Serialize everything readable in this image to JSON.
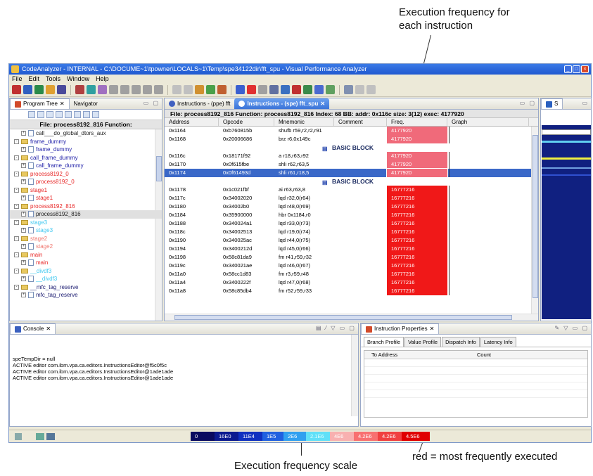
{
  "annotations": {
    "top_right": [
      "Execution frequency for",
      "each instruction"
    ],
    "bottom_center": "Execution frequency scale",
    "bottom_right": "red = most frequently executed"
  },
  "window": {
    "title": "CodeAnalyzer - INTERNAL - C:\\DOCUME~1\\tpowner\\LOCALS~1\\Temp\\spe34122dir\\fft_spu - Visual Performance Analyzer",
    "menu": [
      "File",
      "Edit",
      "Tools",
      "Window",
      "Help"
    ]
  },
  "tree_pane": {
    "tabs": [
      "Program Tree",
      "Navigator"
    ],
    "title": "File: process8192_816 Function:",
    "items": [
      {
        "label": "call___do_global_dtors_aux",
        "color": "dark",
        "kind": "file",
        "expand": "+"
      },
      {
        "label": "frame_dummy",
        "color": "blue",
        "kind": "folder",
        "expand": "-"
      },
      {
        "label": "frame_dummy",
        "color": "blue",
        "kind": "file",
        "expand": "+"
      },
      {
        "label": "call_frame_dummy",
        "color": "blue",
        "kind": "folder",
        "expand": "-"
      },
      {
        "label": "call_frame_dummy",
        "color": "blue",
        "kind": "file",
        "expand": "+"
      },
      {
        "label": "process8192_0",
        "color": "red",
        "kind": "folder",
        "expand": "-"
      },
      {
        "label": "process8192_0",
        "color": "red",
        "kind": "file",
        "expand": "+"
      },
      {
        "label": "stage1",
        "color": "red",
        "kind": "folder",
        "expand": "-"
      },
      {
        "label": "stage1",
        "color": "red",
        "kind": "file",
        "expand": "+"
      },
      {
        "label": "process8192_816",
        "color": "red",
        "kind": "folder",
        "expand": "-"
      },
      {
        "label": "process8192_816",
        "color": "dark",
        "kind": "file",
        "expand": "+",
        "selected": true
      },
      {
        "label": "stage3",
        "color": "cyan",
        "kind": "folder",
        "expand": "-"
      },
      {
        "label": "stage3",
        "color": "cyan",
        "kind": "file",
        "expand": "+"
      },
      {
        "label": "stage2",
        "color": "pink",
        "kind": "folder",
        "expand": "-"
      },
      {
        "label": "stage2",
        "color": "pink",
        "kind": "file",
        "expand": "+"
      },
      {
        "label": "main",
        "color": "red",
        "kind": "folder",
        "expand": "-"
      },
      {
        "label": "main",
        "color": "red",
        "kind": "file",
        "expand": "+"
      },
      {
        "label": "__divdf3",
        "color": "cyan",
        "kind": "folder",
        "expand": "-"
      },
      {
        "label": "__divdf3",
        "color": "cyan",
        "kind": "file",
        "expand": "+"
      },
      {
        "label": "__mfc_tag_reserve",
        "color": "navy",
        "kind": "folder",
        "expand": "-"
      },
      {
        "label": "mfc_tag_reserve",
        "color": "navy",
        "kind": "file",
        "expand": "+"
      }
    ]
  },
  "instr_pane": {
    "tabs": [
      "Instructions - (ppe) fft",
      "Instructions - (spe) fft_spu"
    ],
    "title": "File: process8192_816  Function: process8192_816  Index: 68 BB: addr: 0x116c size: 3(12) exec: 4177920",
    "columns": [
      "Address",
      "Opcode",
      "Mnemonic",
      "Comment",
      "Freq.",
      "Graph"
    ],
    "basic_block_label": "BASIC BLOCK",
    "rows": [
      {
        "type": "row",
        "address": "0x1164",
        "opcode": "0xb760815b",
        "mnemonic": "shufb r59,r2,r2,r91",
        "freq": "4177920",
        "level": "mid"
      },
      {
        "type": "row",
        "address": "0x1168",
        "opcode": "0x20006686",
        "mnemonic": "brz r6,0x149c",
        "freq": "4177920",
        "level": "mid"
      },
      {
        "type": "bb"
      },
      {
        "type": "row",
        "address": "0x116c",
        "opcode": "0x18171f92",
        "mnemonic": "a r18,r63,r92",
        "freq": "4177920",
        "level": "mid"
      },
      {
        "type": "row",
        "address": "0x1170",
        "opcode": "0x0f615fbe",
        "mnemonic": "shli r62,r63,5",
        "freq": "4177920",
        "level": "mid"
      },
      {
        "type": "row",
        "address": "0x1174",
        "opcode": "0x0f61493d",
        "mnemonic": "shli r61,r18,5",
        "freq": "4177920",
        "level": "mid",
        "highlight": true
      },
      {
        "type": "bb"
      },
      {
        "type": "row",
        "address": "0x1178",
        "opcode": "0x1c021fbf",
        "mnemonic": "ai r63,r63,8",
        "freq": "16777216",
        "level": "high"
      },
      {
        "type": "row",
        "address": "0x117c",
        "opcode": "0x34002020",
        "mnemonic": "lqd r32,0(r64)",
        "freq": "16777216",
        "level": "high"
      },
      {
        "type": "row",
        "address": "0x1180",
        "opcode": "0x34002b0",
        "mnemonic": "lqd r48,0(r69)",
        "freq": "16777216",
        "level": "high"
      },
      {
        "type": "row",
        "address": "0x1184",
        "opcode": "0x35900000",
        "mnemonic": "hbr 0x1184,r0",
        "freq": "16777216",
        "level": "high"
      },
      {
        "type": "row",
        "address": "0x1188",
        "opcode": "0x340024a1",
        "mnemonic": "lqd r33,0(r73)",
        "freq": "16777216",
        "level": "high"
      },
      {
        "type": "row",
        "address": "0x118c",
        "opcode": "0x34002513",
        "mnemonic": "lqd r19,0(r74)",
        "freq": "16777216",
        "level": "high"
      },
      {
        "type": "row",
        "address": "0x1190",
        "opcode": "0x340025ac",
        "mnemonic": "lqd r44,0(r75)",
        "freq": "16777216",
        "level": "high"
      },
      {
        "type": "row",
        "address": "0x1194",
        "opcode": "0x3400212d",
        "mnemonic": "lqd r45,0(r66)",
        "freq": "16777216",
        "level": "high"
      },
      {
        "type": "row",
        "address": "0x1198",
        "opcode": "0x58c81da9",
        "mnemonic": "fm r41,r59,r32",
        "freq": "16777216",
        "level": "high"
      },
      {
        "type": "row",
        "address": "0x119c",
        "opcode": "0x340021ae",
        "mnemonic": "lqd r46,0(r67)",
        "freq": "16777216",
        "level": "high"
      },
      {
        "type": "row",
        "address": "0x11a0",
        "opcode": "0x58cc1d83",
        "mnemonic": "fm r3,r59,r48",
        "freq": "16777216",
        "level": "high"
      },
      {
        "type": "row",
        "address": "0x11a4",
        "opcode": "0x3400222f",
        "mnemonic": "lqd r47,0(r68)",
        "freq": "16777216",
        "level": "high"
      },
      {
        "type": "row",
        "address": "0x11a8",
        "opcode": "0x58c85db4",
        "mnemonic": "fm r52,r59,r33",
        "freq": "16777216",
        "level": "high"
      }
    ]
  },
  "mini_pane": {
    "tab": "S"
  },
  "console": {
    "tab": "Console",
    "lines": [
      "speTempDir = null",
      "ACTIVE editor com.ibm.vpa.ca.editors.InstructionsEditor@f5c0f5c",
      "ACTIVE editor com.ibm.vpa.ca.editors.InstructionsEditor@1ade1ade",
      "ACTIVE editor com.ibm.vpa.ca.editors.InstructionsEditor@1ade1ade"
    ]
  },
  "props": {
    "tab": "Instruction Properties",
    "subtabs": [
      "Branch Profile",
      "Value Profile",
      "Dispatch Info",
      "Latency Info"
    ],
    "columns": [
      "To Address",
      "Count"
    ]
  },
  "scale": {
    "labels": [
      "0",
      "16E0",
      "11E4",
      "1E5",
      "2E6",
      "2.1E6",
      "4E6",
      "4.2E6",
      "4.2E6",
      "4.5E6"
    ],
    "colors": [
      "#0a0a60",
      "#0c1a90",
      "#1030c0",
      "#2060e0",
      "#30a0f0",
      "#60e0f8",
      "#f8b0b0",
      "#f87070",
      "#f04040",
      "#e00000"
    ]
  },
  "colors": {
    "freq_mid": "#f06a7a",
    "freq_high": "#f01818",
    "highlight": "#3a68c8"
  }
}
